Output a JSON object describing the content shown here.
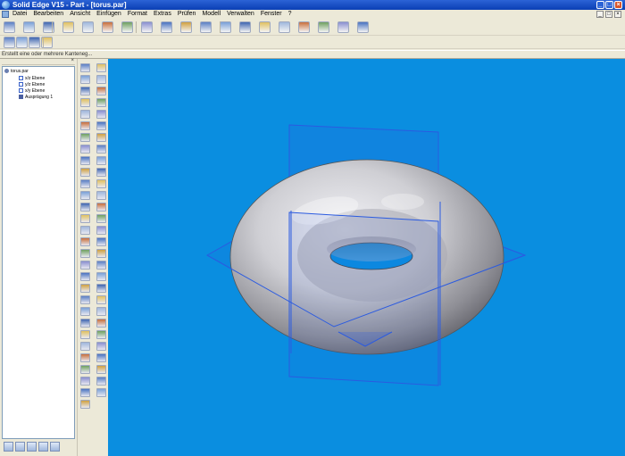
{
  "window": {
    "title": "Solid Edge V15 - Part - [torus.par]",
    "min_symbol": "_",
    "max_symbol": "□",
    "close_symbol": "×",
    "colors": {
      "titlebar": "#0a3fb4",
      "viewport": "#0a8ee0",
      "torus": "#c8c8cc",
      "refplane": "#2b5be0"
    }
  },
  "menu": {
    "items": [
      "Datei",
      "Bearbeiten",
      "Ansicht",
      "Einfügen",
      "Format",
      "Extras",
      "Prüfen",
      "Modell",
      "Verwalten",
      "Fenster",
      "?"
    ],
    "doc_buttons": [
      "_",
      "□",
      "×"
    ]
  },
  "prompt": {
    "text": "Erstellt eine oder mehrere Kanteneg..."
  },
  "edgebar": {
    "close_symbol": "×",
    "tree": [
      {
        "label": "torus.par",
        "icon": "part-icon"
      },
      {
        "label": "x/z Ebene",
        "icon": "plane-icon"
      },
      {
        "label": "y/z Ebene",
        "icon": "plane-icon"
      },
      {
        "label": "x/y Ebene",
        "icon": "plane-icon"
      },
      {
        "label": "Ausprägung 1",
        "icon": "revolve-feature-icon"
      }
    ],
    "tabs": [
      "feature-pathfinder-icon",
      "layers-icon",
      "family-icon",
      "feature-library-icon",
      "sensors-icon"
    ]
  },
  "toolbar": {
    "standard": [
      "new-icon",
      "open-icon",
      "save-icon",
      "print-icon",
      "cut-icon",
      "copy-icon",
      "paste-icon",
      "undo-icon",
      "redo-icon",
      "select-icon",
      "zoom-area-icon",
      "zoom-icon",
      "fit-icon",
      "pan-icon",
      "rotate-icon",
      "shade-icon",
      "view-orient-icon",
      "display-icon",
      "help-icon"
    ],
    "selection": [
      "select-tool-icon",
      "select-face-icon",
      "select-edge-icon",
      "sketch-view-icon"
    ]
  }
}
